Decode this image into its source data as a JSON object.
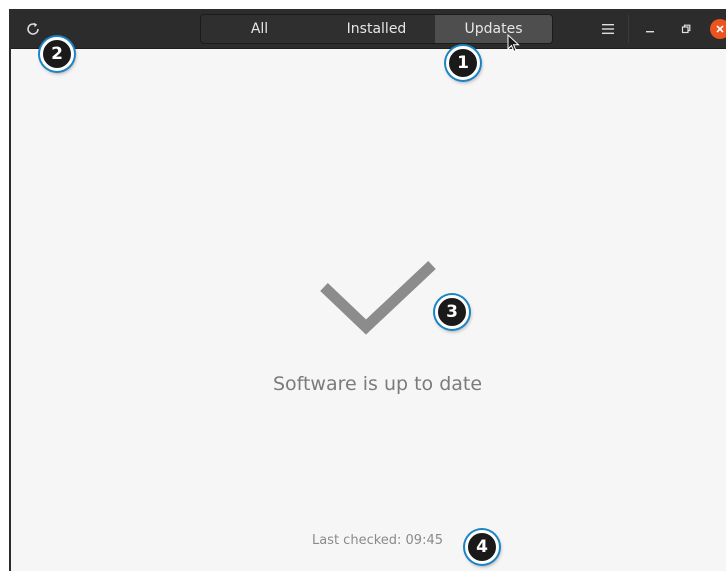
{
  "header": {
    "tabs": [
      {
        "label": "All",
        "active": false
      },
      {
        "label": "Installed",
        "active": false
      },
      {
        "label": "Updates",
        "active": true
      }
    ],
    "icons": [
      "refresh-icon",
      "hamburger-menu-icon",
      "minimize-icon",
      "restore-icon",
      "close-icon"
    ]
  },
  "main": {
    "status_icon": "checkmark-icon",
    "status_text": "Software is up to date",
    "last_checked": "Last checked: 09:45"
  },
  "callouts": [
    "1",
    "2",
    "3",
    "4"
  ],
  "colors": {
    "headerbar": "#2c2c2c",
    "active_tab": "#4e4e4e",
    "content_bg": "#f6f6f7",
    "checkmark": "#8c8c8c",
    "close_button": "#e95420",
    "callout_ring": "#1a83c4"
  }
}
